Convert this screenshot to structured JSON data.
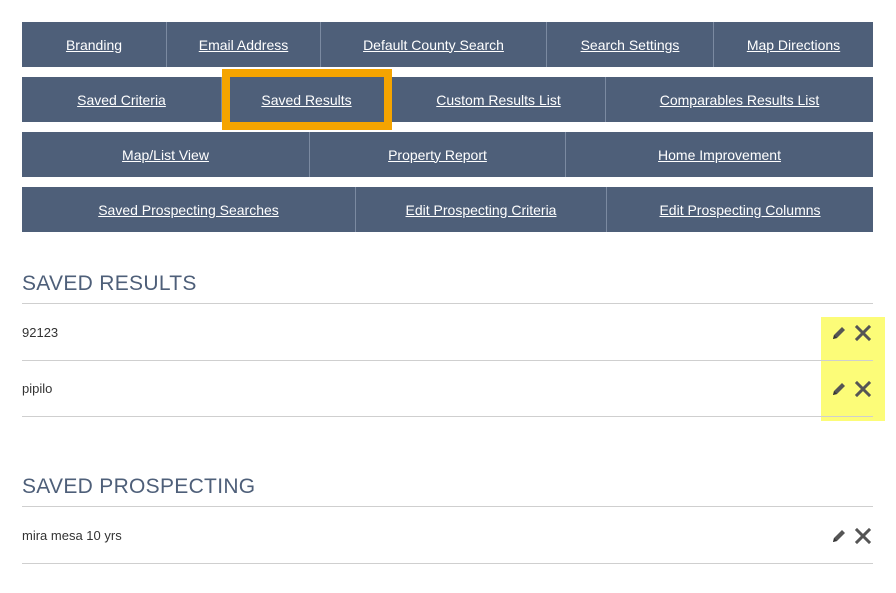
{
  "nav": {
    "row1": [
      "Branding",
      "Email Address",
      "Default County Search",
      "Search Settings",
      "Map Directions"
    ],
    "row2": [
      "Saved Criteria",
      "Saved Results",
      "Custom Results List",
      "Comparables Results List"
    ],
    "row3": [
      "Map/List View",
      "Property Report",
      "Home Improvement"
    ],
    "row4": [
      "Saved Prospecting Searches",
      "Edit Prospecting Criteria",
      "Edit Prospecting Columns"
    ]
  },
  "saved_results": {
    "title": "SAVED RESULTS",
    "items": [
      "92123",
      "pipilo"
    ]
  },
  "saved_prospecting": {
    "title": "SAVED PROSPECTING",
    "items": [
      "mira mesa 10 yrs"
    ]
  },
  "colors": {
    "nav_bg": "#4e5f79",
    "highlight_orange": "#f5a400",
    "highlight_yellow": "#fbfb4b"
  },
  "icons": {
    "edit": "pencil-icon",
    "delete": "close-icon"
  }
}
